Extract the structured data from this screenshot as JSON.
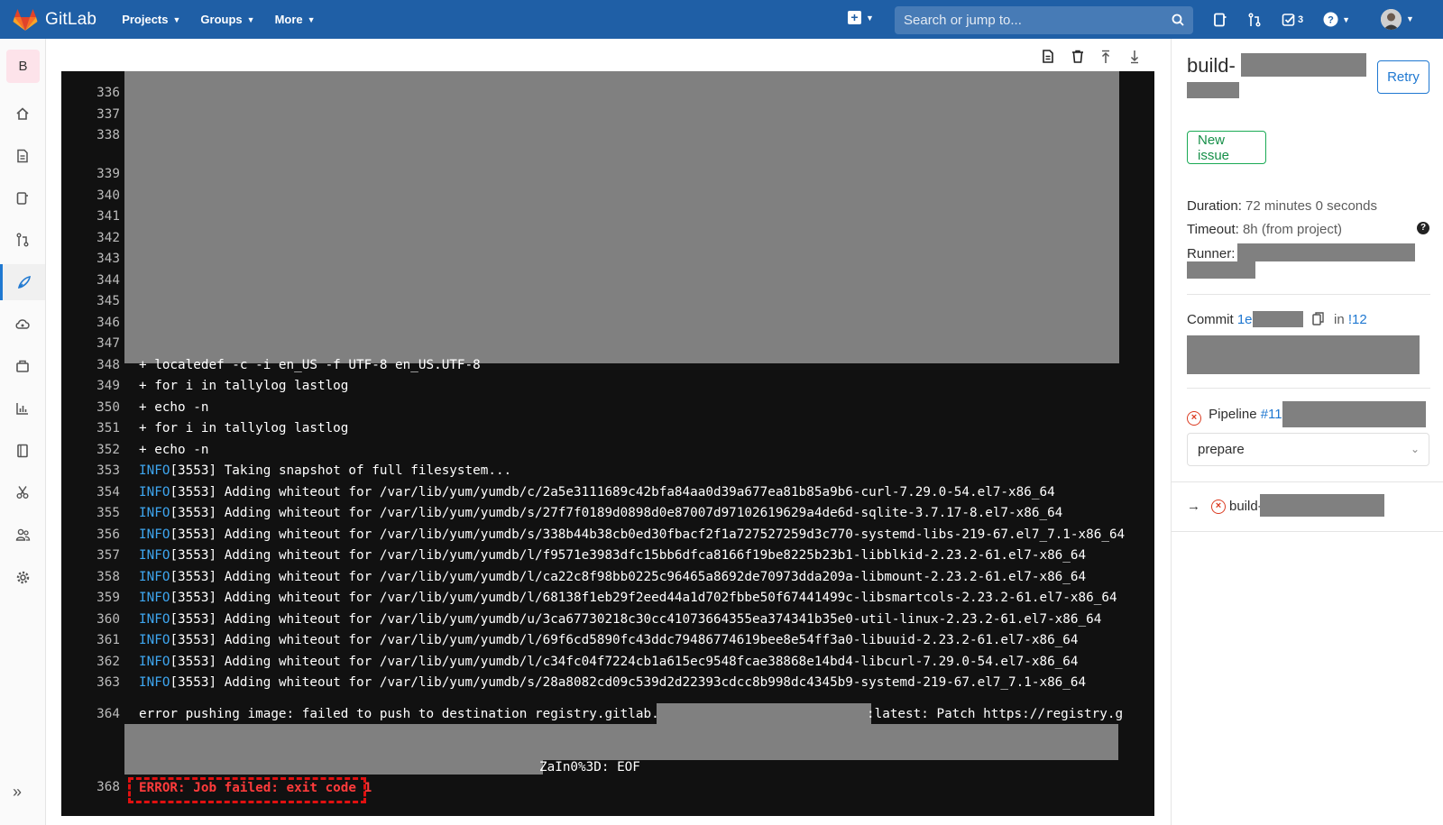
{
  "nav": {
    "brand": "GitLab",
    "menu": [
      {
        "label": "Projects"
      },
      {
        "label": "Groups"
      },
      {
        "label": "More"
      }
    ],
    "search_placeholder": "Search or jump to...",
    "todos_count": "3"
  },
  "sidebar": {
    "project_initial": "B",
    "items": [
      "home-icon",
      "repository-icon",
      "issues-icon",
      "merge-requests-icon",
      "ci-cd-icon",
      "operations-icon",
      "packages-icon",
      "analytics-icon",
      "wiki-icon",
      "snippets-icon",
      "members-icon",
      "settings-icon"
    ],
    "collapse": "»"
  },
  "log": {
    "lines": [
      {
        "n": "336",
        "t": ""
      },
      {
        "n": "337",
        "t": ""
      },
      {
        "n": "338",
        "t": ""
      },
      {
        "n": "339",
        "t": ""
      },
      {
        "n": "340",
        "t": ""
      },
      {
        "n": "341",
        "t": ""
      },
      {
        "n": "342",
        "t": ""
      },
      {
        "n": "343",
        "t": ""
      },
      {
        "n": "344",
        "t": ""
      },
      {
        "n": "345",
        "t": ""
      },
      {
        "n": "346",
        "t": ""
      },
      {
        "n": "347",
        "t": ""
      },
      {
        "n": "348",
        "t": "+ localedef -c -i en_US -f UTF-8 en_US.UTF-8"
      },
      {
        "n": "349",
        "t": "+ for i in tallylog lastlog"
      },
      {
        "n": "350",
        "t": "+ echo -n"
      },
      {
        "n": "351",
        "t": "+ for i in tallylog lastlog"
      },
      {
        "n": "352",
        "t": "+ echo -n"
      },
      {
        "n": "353",
        "info": "INFO",
        "t": "[3553] Taking snapshot of full filesystem..."
      },
      {
        "n": "354",
        "info": "INFO",
        "t": "[3553] Adding whiteout for /var/lib/yum/yumdb/c/2a5e3111689c42bfa84aa0d39a677ea81b85a9b6-curl-7.29.0-54.el7-x86_64"
      },
      {
        "n": "355",
        "info": "INFO",
        "t": "[3553] Adding whiteout for /var/lib/yum/yumdb/s/27f7f0189d0898d0e87007d97102619629a4de6d-sqlite-3.7.17-8.el7-x86_64"
      },
      {
        "n": "356",
        "info": "INFO",
        "t": "[3553] Adding whiteout for /var/lib/yum/yumdb/s/338b44b38cb0ed30fbacf2f1a727527259d3c770-systemd-libs-219-67.el7_7.1-x86_64"
      },
      {
        "n": "357",
        "info": "INFO",
        "t": "[3553] Adding whiteout for /var/lib/yum/yumdb/l/f9571e3983dfc15bb6dfca8166f19be8225b23b1-libblkid-2.23.2-61.el7-x86_64"
      },
      {
        "n": "358",
        "info": "INFO",
        "t": "[3553] Adding whiteout for /var/lib/yum/yumdb/l/ca22c8f98bb0225c96465a8692de70973dda209a-libmount-2.23.2-61.el7-x86_64"
      },
      {
        "n": "359",
        "info": "INFO",
        "t": "[3553] Adding whiteout for /var/lib/yum/yumdb/l/68138f1eb29f2eed44a1d702fbbe50f67441499c-libsmartcols-2.23.2-61.el7-x86_64"
      },
      {
        "n": "360",
        "info": "INFO",
        "t": "[3553] Adding whiteout for /var/lib/yum/yumdb/u/3ca67730218c30cc41073664355ea374341b35e0-util-linux-2.23.2-61.el7-x86_64"
      },
      {
        "n": "361",
        "info": "INFO",
        "t": "[3553] Adding whiteout for /var/lib/yum/yumdb/l/69f6cd5890fc43ddc79486774619bee8e54ff3a0-libuuid-2.23.2-61.el7-x86_64"
      },
      {
        "n": "362",
        "info": "INFO",
        "t": "[3553] Adding whiteout for /var/lib/yum/yumdb/l/c34fc04f7224cb1a615ec9548fcae38868e14bd4-libcurl-7.29.0-54.el7-x86_64"
      },
      {
        "n": "363",
        "info": "INFO",
        "t": "[3553] Adding whiteout for /var/lib/yum/yumdb/s/28a8082cd09c539d2d22393cdcc8b998dc4345b9-systemd-219-67.el7_7.1-x86_64"
      }
    ],
    "line364_num": "364",
    "line364_a": "error pushing image: failed to push to destination registry.gitlab.com/",
    "line364_b": ":latest: Patch https://registry.g",
    "line367_tail": "ZaIn0%3D: EOF",
    "line368_num": "368",
    "error_text": "ERROR: Job failed: exit code 1"
  },
  "panel": {
    "title": "build-",
    "retry": "Retry",
    "new_issue": "New issue",
    "duration_label": "Duration:",
    "duration_value": "72 minutes 0 seconds",
    "timeout_label": "Timeout:",
    "timeout_value": "8h (from project)",
    "runner_label": "Runner:",
    "commit_label": "Commit",
    "commit_sha": "1e",
    "commit_in": "in",
    "commit_mr": "!12",
    "pipeline_label": "Pipeline",
    "pipeline_id": "#11",
    "stage_selected": "prepare",
    "job_arrow": "→",
    "job_name": "build-"
  }
}
